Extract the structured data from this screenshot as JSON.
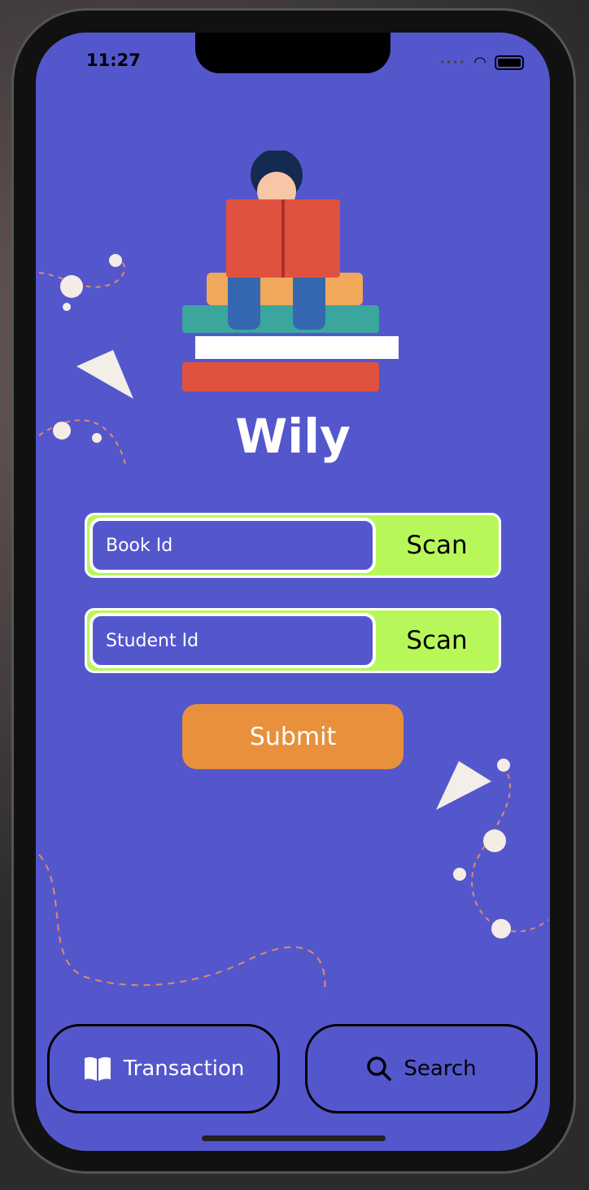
{
  "status_bar": {
    "time": "11:27"
  },
  "app": {
    "title": "Wily",
    "illustration": "child-reading-on-books"
  },
  "form": {
    "book_id": {
      "placeholder": "Book Id",
      "value": "",
      "scan_label": "Scan"
    },
    "student_id": {
      "placeholder": "Student Id",
      "value": "",
      "scan_label": "Scan"
    },
    "submit_label": "Submit"
  },
  "tabs": [
    {
      "label": "Transaction",
      "icon": "book-open-icon",
      "active": true
    },
    {
      "label": "Search",
      "icon": "search-icon",
      "active": false
    }
  ],
  "colors": {
    "background": "#5457cc",
    "scan": "#b8f75a",
    "submit": "#e8903c"
  }
}
